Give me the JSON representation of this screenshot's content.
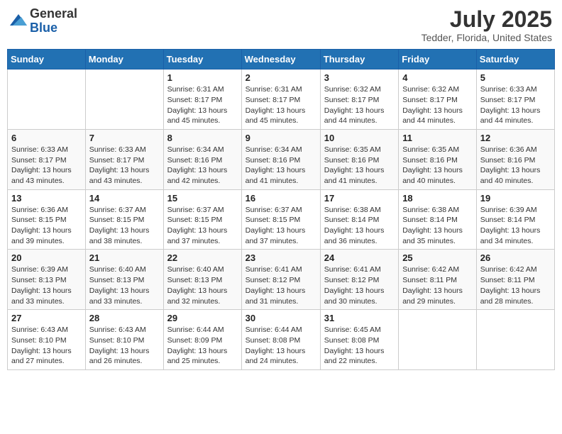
{
  "logo": {
    "general": "General",
    "blue": "Blue"
  },
  "title": "July 2025",
  "subtitle": "Tedder, Florida, United States",
  "days_of_week": [
    "Sunday",
    "Monday",
    "Tuesday",
    "Wednesday",
    "Thursday",
    "Friday",
    "Saturday"
  ],
  "weeks": [
    [
      {
        "day": "",
        "info": ""
      },
      {
        "day": "",
        "info": ""
      },
      {
        "day": "1",
        "info": "Sunrise: 6:31 AM\nSunset: 8:17 PM\nDaylight: 13 hours and 45 minutes."
      },
      {
        "day": "2",
        "info": "Sunrise: 6:31 AM\nSunset: 8:17 PM\nDaylight: 13 hours and 45 minutes."
      },
      {
        "day": "3",
        "info": "Sunrise: 6:32 AM\nSunset: 8:17 PM\nDaylight: 13 hours and 44 minutes."
      },
      {
        "day": "4",
        "info": "Sunrise: 6:32 AM\nSunset: 8:17 PM\nDaylight: 13 hours and 44 minutes."
      },
      {
        "day": "5",
        "info": "Sunrise: 6:33 AM\nSunset: 8:17 PM\nDaylight: 13 hours and 44 minutes."
      }
    ],
    [
      {
        "day": "6",
        "info": "Sunrise: 6:33 AM\nSunset: 8:17 PM\nDaylight: 13 hours and 43 minutes."
      },
      {
        "day": "7",
        "info": "Sunrise: 6:33 AM\nSunset: 8:17 PM\nDaylight: 13 hours and 43 minutes."
      },
      {
        "day": "8",
        "info": "Sunrise: 6:34 AM\nSunset: 8:16 PM\nDaylight: 13 hours and 42 minutes."
      },
      {
        "day": "9",
        "info": "Sunrise: 6:34 AM\nSunset: 8:16 PM\nDaylight: 13 hours and 41 minutes."
      },
      {
        "day": "10",
        "info": "Sunrise: 6:35 AM\nSunset: 8:16 PM\nDaylight: 13 hours and 41 minutes."
      },
      {
        "day": "11",
        "info": "Sunrise: 6:35 AM\nSunset: 8:16 PM\nDaylight: 13 hours and 40 minutes."
      },
      {
        "day": "12",
        "info": "Sunrise: 6:36 AM\nSunset: 8:16 PM\nDaylight: 13 hours and 40 minutes."
      }
    ],
    [
      {
        "day": "13",
        "info": "Sunrise: 6:36 AM\nSunset: 8:15 PM\nDaylight: 13 hours and 39 minutes."
      },
      {
        "day": "14",
        "info": "Sunrise: 6:37 AM\nSunset: 8:15 PM\nDaylight: 13 hours and 38 minutes."
      },
      {
        "day": "15",
        "info": "Sunrise: 6:37 AM\nSunset: 8:15 PM\nDaylight: 13 hours and 37 minutes."
      },
      {
        "day": "16",
        "info": "Sunrise: 6:37 AM\nSunset: 8:15 PM\nDaylight: 13 hours and 37 minutes."
      },
      {
        "day": "17",
        "info": "Sunrise: 6:38 AM\nSunset: 8:14 PM\nDaylight: 13 hours and 36 minutes."
      },
      {
        "day": "18",
        "info": "Sunrise: 6:38 AM\nSunset: 8:14 PM\nDaylight: 13 hours and 35 minutes."
      },
      {
        "day": "19",
        "info": "Sunrise: 6:39 AM\nSunset: 8:14 PM\nDaylight: 13 hours and 34 minutes."
      }
    ],
    [
      {
        "day": "20",
        "info": "Sunrise: 6:39 AM\nSunset: 8:13 PM\nDaylight: 13 hours and 33 minutes."
      },
      {
        "day": "21",
        "info": "Sunrise: 6:40 AM\nSunset: 8:13 PM\nDaylight: 13 hours and 33 minutes."
      },
      {
        "day": "22",
        "info": "Sunrise: 6:40 AM\nSunset: 8:13 PM\nDaylight: 13 hours and 32 minutes."
      },
      {
        "day": "23",
        "info": "Sunrise: 6:41 AM\nSunset: 8:12 PM\nDaylight: 13 hours and 31 minutes."
      },
      {
        "day": "24",
        "info": "Sunrise: 6:41 AM\nSunset: 8:12 PM\nDaylight: 13 hours and 30 minutes."
      },
      {
        "day": "25",
        "info": "Sunrise: 6:42 AM\nSunset: 8:11 PM\nDaylight: 13 hours and 29 minutes."
      },
      {
        "day": "26",
        "info": "Sunrise: 6:42 AM\nSunset: 8:11 PM\nDaylight: 13 hours and 28 minutes."
      }
    ],
    [
      {
        "day": "27",
        "info": "Sunrise: 6:43 AM\nSunset: 8:10 PM\nDaylight: 13 hours and 27 minutes."
      },
      {
        "day": "28",
        "info": "Sunrise: 6:43 AM\nSunset: 8:10 PM\nDaylight: 13 hours and 26 minutes."
      },
      {
        "day": "29",
        "info": "Sunrise: 6:44 AM\nSunset: 8:09 PM\nDaylight: 13 hours and 25 minutes."
      },
      {
        "day": "30",
        "info": "Sunrise: 6:44 AM\nSunset: 8:08 PM\nDaylight: 13 hours and 24 minutes."
      },
      {
        "day": "31",
        "info": "Sunrise: 6:45 AM\nSunset: 8:08 PM\nDaylight: 13 hours and 22 minutes."
      },
      {
        "day": "",
        "info": ""
      },
      {
        "day": "",
        "info": ""
      }
    ]
  ]
}
